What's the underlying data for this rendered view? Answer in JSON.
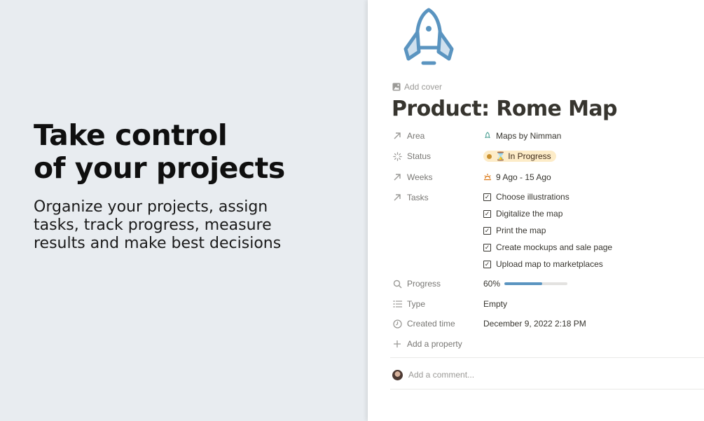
{
  "hero": {
    "headline_line1": "Take control",
    "headline_line2": "of your projects",
    "subtext": "Organize your projects, assign tasks, track progress, measure results and make best decisions"
  },
  "page": {
    "icon": "rocket-icon",
    "add_cover": "Add cover",
    "title": "Product: Rome Map",
    "properties": {
      "area": {
        "label": "Area",
        "value": "Maps by Nimman",
        "icon": "arrow-up-right-icon",
        "value_icon": "rocket-icon"
      },
      "status": {
        "label": "Status",
        "value": "⌛ In Progress",
        "icon": "loading-spinner-icon",
        "pill_color": "#fdecc8",
        "dot_color": "#cb912f"
      },
      "weeks": {
        "label": "Weeks",
        "value": "9 Ago - 15 Ago",
        "icon": "arrow-up-right-icon",
        "value_icon": "sunrise-icon"
      },
      "tasks": {
        "label": "Tasks",
        "icon": "arrow-up-right-icon",
        "items": [
          "Choose illustrations",
          "Digitalize the map",
          "Print the map",
          "Create mockups and sale page",
          "Upload map to marketplaces"
        ]
      },
      "progress": {
        "label": "Progress",
        "value": "60%",
        "fraction": 0.6,
        "icon": "search-icon",
        "bar_color": "#5a94c0"
      },
      "type": {
        "label": "Type",
        "value": "Empty",
        "icon": "list-icon"
      },
      "created_time": {
        "label": "Created time",
        "value": "December 9, 2022 2:18 PM",
        "icon": "clock-icon"
      }
    },
    "add_property": "Add a property",
    "comment_placeholder": "Add a comment..."
  },
  "colors": {
    "background": "#e8ecf0",
    "rocket_stroke": "#5a94c0",
    "rocket_fill": "#cfe0ee"
  }
}
